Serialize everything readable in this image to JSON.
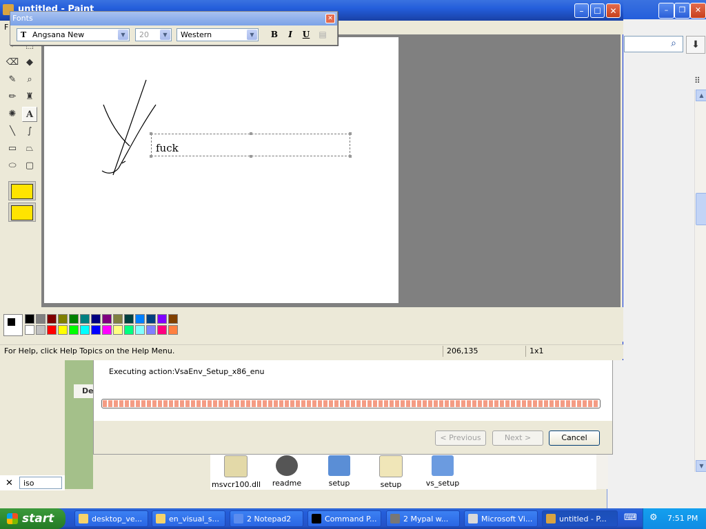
{
  "paint": {
    "title": "untitled - Paint",
    "menu_partial": "F",
    "canvas_text": "fuck",
    "status_help": "For Help, click Help Topics on the Help Menu.",
    "status_coords": "206,135",
    "status_size": "1x1"
  },
  "fonts_toolbar": {
    "title": "Fonts",
    "font_name": "Angsana New",
    "font_size": "20",
    "script": "Western",
    "bold_label": "B",
    "italic_label": "I",
    "underline_label": "U"
  },
  "installer": {
    "status_text": "Executing action:VsaEnv_Setup_x86_enu",
    "progress_percent": 100,
    "previous_label": "< Previous",
    "next_label": "Next >",
    "cancel_label": "Cancel"
  },
  "explorer": {
    "tab_label": "De",
    "find_value": "iso",
    "files": [
      {
        "name": "msvcr100.dll"
      },
      {
        "name": "readme"
      },
      {
        "name": "setup"
      },
      {
        "name": "setup"
      },
      {
        "name": "vs_setup"
      }
    ]
  },
  "palette": {
    "colors": [
      "#000000",
      "#808080",
      "#800000",
      "#808000",
      "#008000",
      "#008080",
      "#000080",
      "#800080",
      "#808040",
      "#004040",
      "#0080ff",
      "#004080",
      "#8000ff",
      "#804000",
      "#ffffff",
      "#c0c0c0",
      "#ff0000",
      "#ffff00",
      "#00ff00",
      "#00ffff",
      "#0000ff",
      "#ff00ff",
      "#ffff80",
      "#00ff80",
      "#80ffff",
      "#8080ff",
      "#ff0080",
      "#ff8040"
    ]
  },
  "taskbar": {
    "start_label": "start",
    "tasks": [
      {
        "label": "desktop_ve..."
      },
      {
        "label": "en_visual_s..."
      },
      {
        "label": "2 Notepad2"
      },
      {
        "label": "Command P..."
      },
      {
        "label": "2 Mypal w..."
      },
      {
        "label": "Microsoft Vi..."
      },
      {
        "label": "untitled - P..."
      }
    ],
    "clock": "7:51 PM"
  }
}
